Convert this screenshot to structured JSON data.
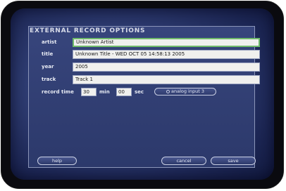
{
  "dialog": {
    "title": "EXTERNAL RECORD OPTIONS"
  },
  "fields": {
    "artist": {
      "label": "artist",
      "value": "Unknown Artist"
    },
    "title": {
      "label": "title",
      "value": "Unknown Title - WED OCT 05 14:58:13 2005"
    },
    "year": {
      "label": "year",
      "value": "2005"
    },
    "track": {
      "label": "track",
      "value": "Track 1"
    }
  },
  "record_time": {
    "label": "record time",
    "minutes_value": "30",
    "minutes_unit": "min",
    "seconds_value": "00",
    "seconds_unit": "sec",
    "input_selector": "analog input 3"
  },
  "buttons": {
    "help": "help",
    "cancel": "cancel",
    "save": "save"
  },
  "colors": {
    "screen_bg": "#2e3c72",
    "panel_border": "#8b95b8",
    "active_field_border": "#6fb96a",
    "field_bg": "#f0f0ee"
  }
}
